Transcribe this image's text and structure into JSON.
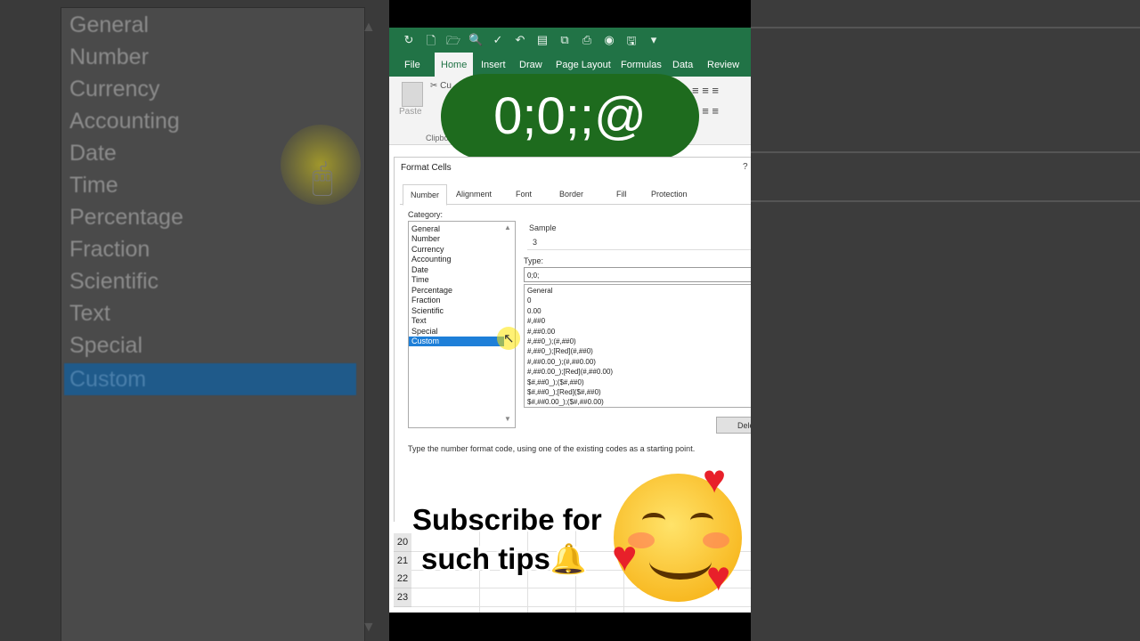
{
  "background_list": {
    "items": [
      "General",
      "Number",
      "Currency",
      "Accounting",
      "Date",
      "Time",
      "Percentage",
      "Fraction",
      "Scientific",
      "Text",
      "Special",
      "Custom"
    ],
    "selected_index": 11
  },
  "excel": {
    "ribbon_tabs": [
      "File",
      "Home",
      "Insert",
      "Draw",
      "Page Layout",
      "Formulas",
      "Data",
      "Review"
    ],
    "active_tab": "Home",
    "paste_label": "Paste",
    "cut_label": "Cu",
    "clipboard_label": "Clipbo"
  },
  "overlay_code": "0;0;;@",
  "dialog": {
    "title": "Format Cells",
    "help": "?",
    "tabs": [
      "Number",
      "Alignment",
      "Font",
      "Border",
      "Fill",
      "Protection"
    ],
    "active_tab": "Number",
    "category_label": "Category:",
    "categories": [
      "General",
      "Number",
      "Currency",
      "Accounting",
      "Date",
      "Time",
      "Percentage",
      "Fraction",
      "Scientific",
      "Text",
      "Special",
      "Custom"
    ],
    "selected_category": "Custom",
    "sample_label": "Sample",
    "sample_value": "3",
    "type_label": "Type:",
    "type_value": "0;0;",
    "formats": [
      "General",
      "0",
      "0.00",
      "#,##0",
      "#,##0.00",
      "#,##0_);(#,##0)",
      "#,##0_);[Red](#,##0)",
      "#,##0.00_);(#,##0.00)",
      "#,##0.00_);[Red](#,##0.00)",
      "$#,##0_);($#,##0)",
      "$#,##0_);[Red]($#,##0)",
      "$#,##0.00_);($#,##0.00)"
    ],
    "delete_button": "Dele",
    "hint": "Type the number format code, using one of the existing codes as a starting point."
  },
  "grid_rows": [
    "20",
    "21",
    "22",
    "23"
  ],
  "promo": {
    "line1": "Subscribe for",
    "line2": "such tips🔔"
  },
  "colors": {
    "excel_green": "#217346",
    "badge_green": "#1e6b1e",
    "selection_blue": "#1e7fd8"
  }
}
